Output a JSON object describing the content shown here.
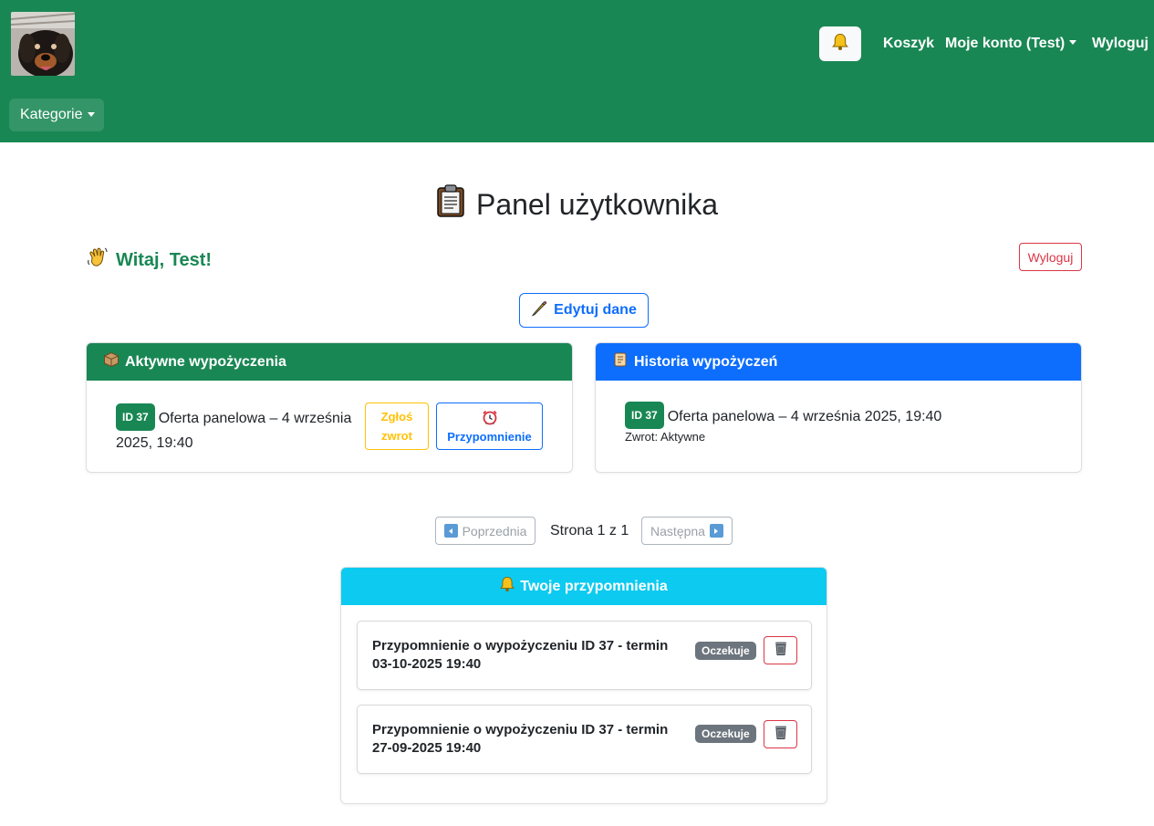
{
  "navbar": {
    "logo_alt": "dog avatar",
    "bell_icon": "bell-icon",
    "cart": "Koszyk",
    "account": "Moje konto (Test)",
    "logout": "Wyloguj",
    "categories": "Kategorie",
    "bg_color": "#198754"
  },
  "page": {
    "title_icon": "clipboard-icon",
    "title": "Panel użytkownika",
    "welcome_icon": "waving-hand-icon",
    "welcome": "Witaj, Test!",
    "logout_button": "Wyloguj",
    "edit_icon": "pencil-icon",
    "edit_button": "Edytuj dane"
  },
  "active_rentals": {
    "header_icon": "package-icon",
    "header": "Aktywne wypożyczenia",
    "header_color": "#198754",
    "items": [
      {
        "id_badge": "ID 37",
        "text": "Oferta panelowa – 4 września 2025, 19:40",
        "return_button": "Zgłoś zwrot",
        "remind_icon": "alarm-clock-icon",
        "remind_button": "Przypomnienie"
      }
    ]
  },
  "history": {
    "header_icon": "scroll-icon",
    "header": "Historia wypożyczeń",
    "header_color": "#0d6efd",
    "items": [
      {
        "id_badge": "ID 37",
        "text": "Oferta panelowa – 4 września 2025, 19:40",
        "status": "Zwrot: Aktywne"
      }
    ]
  },
  "pagination": {
    "prev": "Poprzednia",
    "next": "Następna",
    "info": "Strona 1 z 1"
  },
  "reminders": {
    "header_icon": "bell-icon",
    "header": "Twoje przypomnienia",
    "header_color": "#0dcaf0",
    "items": [
      {
        "text": "Przypomnienie o wypożyczeniu ID 37 - termin 03-10-2025 19:40",
        "status": "Oczekuje"
      },
      {
        "text": "Przypomnienie o wypożyczeniu ID 37 - termin 27-09-2025 19:40",
        "status": "Oczekuje"
      }
    ]
  }
}
